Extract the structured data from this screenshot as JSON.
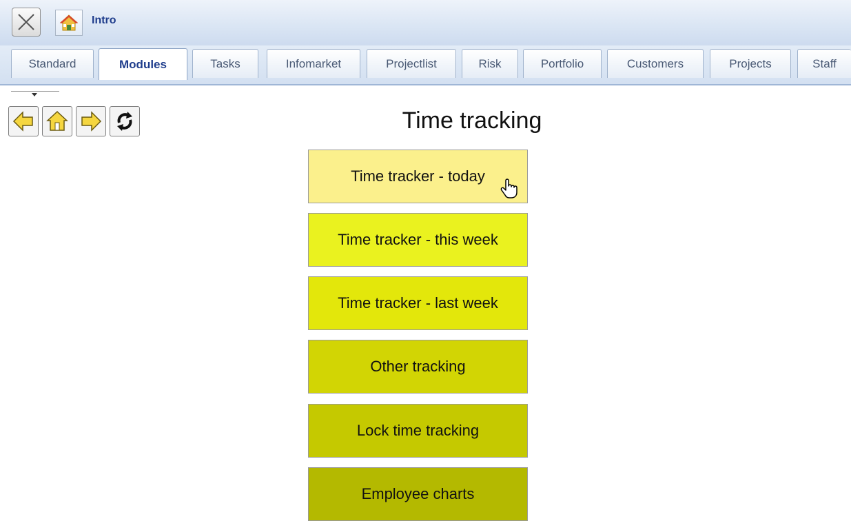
{
  "header": {
    "breadcrumb": "Intro"
  },
  "tabs": [
    {
      "label": "Standard",
      "active": false
    },
    {
      "label": "Modules",
      "active": true
    },
    {
      "label": "Tasks",
      "active": false
    },
    {
      "label": "Infomarket",
      "active": false
    },
    {
      "label": "Projectlist",
      "active": false
    },
    {
      "label": "Risk",
      "active": false
    },
    {
      "label": "Portfolio",
      "active": false
    },
    {
      "label": "Customers",
      "active": false
    },
    {
      "label": "Projects",
      "active": false
    },
    {
      "label": "Staff",
      "active": false
    }
  ],
  "nav": {
    "icons": [
      "back-arrow-icon",
      "home-icon",
      "forward-arrow-icon",
      "refresh-icon"
    ]
  },
  "page": {
    "title": "Time tracking"
  },
  "tiles": [
    {
      "label": "Time tracker - today",
      "color": "#fbf08c"
    },
    {
      "label": "Time tracker - this week",
      "color": "#eaf21f"
    },
    {
      "label": "Time tracker - last week",
      "color": "#e3e70b"
    },
    {
      "label": "Other tracking",
      "color": "#d2d504"
    },
    {
      "label": "Lock time tracking",
      "color": "#c5c900"
    },
    {
      "label": "Employee charts",
      "color": "#b4b900"
    }
  ],
  "colors": {
    "accent": "#1f3d8c",
    "tab_bar": "#d3e0f1"
  }
}
